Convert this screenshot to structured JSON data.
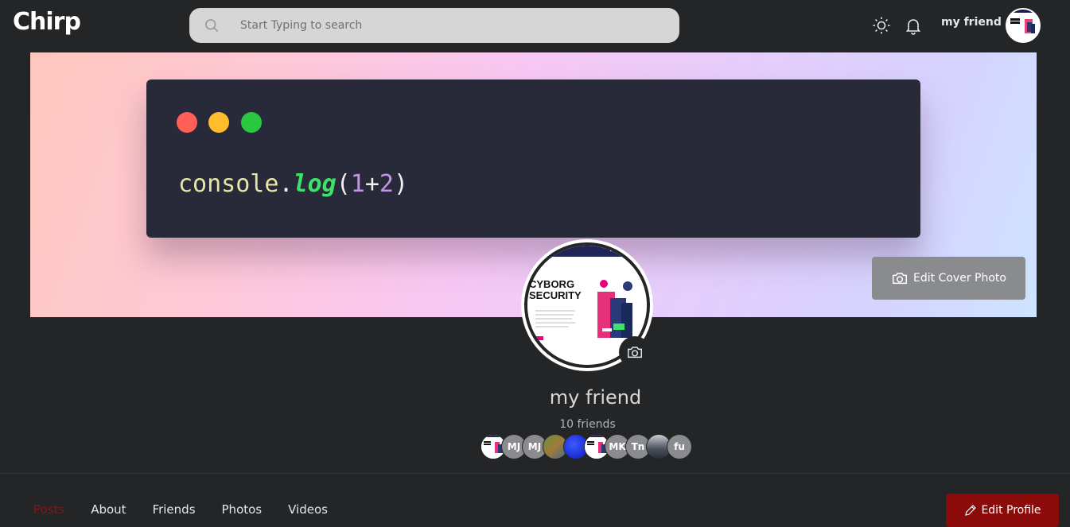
{
  "header": {
    "logo": "Chirp",
    "search_placeholder": "Start Typing to search",
    "user_name": "my friend"
  },
  "cover": {
    "code": {
      "object": "console",
      "dot": ".",
      "method": "log",
      "open": "(",
      "num1": "1",
      "plus": "+",
      "num2": "2",
      "close": ")"
    },
    "edit_cover_label": "Edit Cover Photo"
  },
  "profile": {
    "name": "my friend",
    "friend_count": "10 friends",
    "avatar_card": {
      "title_line1": "CYBORG",
      "title_line2": "SECURITY"
    },
    "friends": [
      {
        "initials": "",
        "kind": "image-cyborg"
      },
      {
        "initials": "MJ",
        "kind": "initials"
      },
      {
        "initials": "MJ",
        "kind": "initials"
      },
      {
        "initials": "",
        "kind": "image-landscape"
      },
      {
        "initials": "",
        "kind": "image-blue"
      },
      {
        "initials": "",
        "kind": "image-cyborg"
      },
      {
        "initials": "MK",
        "kind": "initials"
      },
      {
        "initials": "Tn",
        "kind": "initials"
      },
      {
        "initials": "",
        "kind": "image-group"
      },
      {
        "initials": "fu",
        "kind": "initials"
      }
    ]
  },
  "tabs": [
    {
      "label": "Posts",
      "active": true
    },
    {
      "label": "About",
      "active": false
    },
    {
      "label": "Friends",
      "active": false
    },
    {
      "label": "Photos",
      "active": false
    },
    {
      "label": "Videos",
      "active": false
    }
  ],
  "edit_profile_label": "Edit Profile",
  "colors": {
    "accent": "#8b0a0a",
    "background": "#242526",
    "search_bg": "#d6d6d6"
  }
}
